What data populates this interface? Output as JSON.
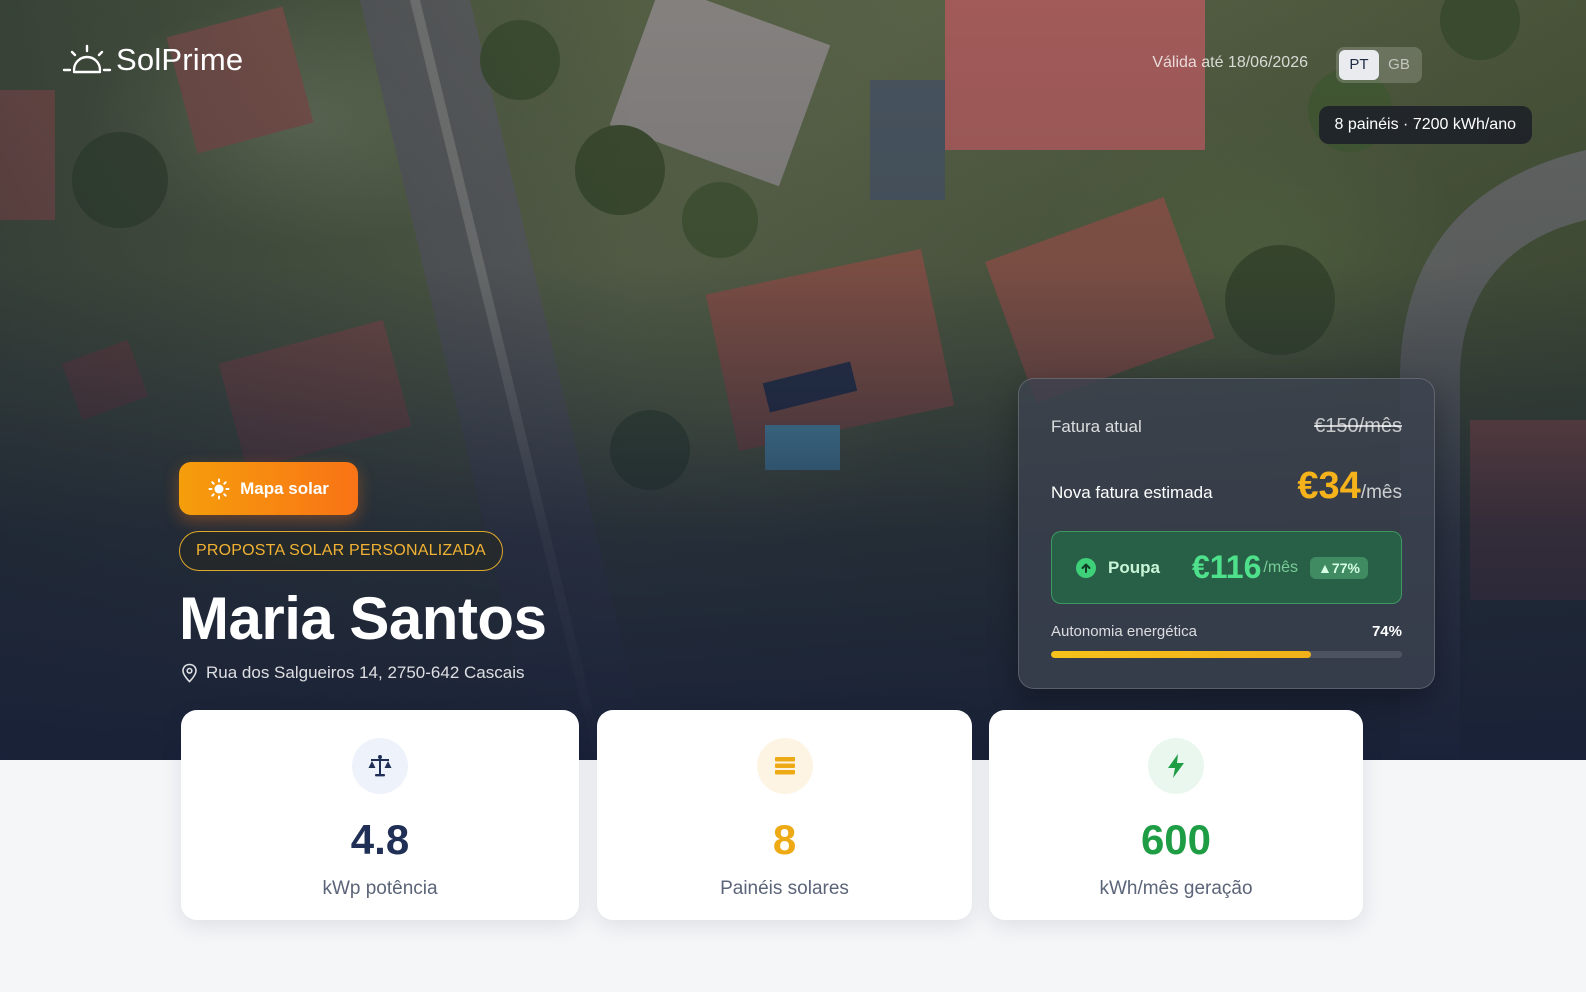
{
  "brand": {
    "name": "SolPrime",
    "icon": "sun-horizon-icon"
  },
  "validity": "Válida até 18/06/2026",
  "languages": [
    {
      "code": "PT",
      "active": true
    },
    {
      "code": "GB",
      "active": false
    }
  ],
  "system_summary": "8 painéis · 7200 kWh/ano",
  "hero": {
    "map_button_label": "Mapa solar",
    "proposal_tag": "PROPOSTA SOLAR PERSONALIZADA",
    "client_name": "Maria Santos",
    "address": "Rua dos Salgueiros 14, 2750-642 Cascais"
  },
  "savings": {
    "current_label": "Fatura atual",
    "current_value": "€150/mês",
    "new_label": "Nova fatura estimada",
    "new_value": "€34",
    "new_unit": "/mês",
    "save_label": "Poupa",
    "save_value": "€116",
    "save_unit": "/mês",
    "save_pct": "▲77%",
    "autonomy_label": "Autonomia energética",
    "autonomy_value": "74%",
    "autonomy_fraction": 0.74
  },
  "stats": [
    {
      "value": "4.8",
      "label": "kWp potência",
      "icon": "scale-icon",
      "color": "#1f2f55",
      "icon_bg": "#eef2fb"
    },
    {
      "value": "8",
      "label": "Painéis solares",
      "icon": "solar-panel-icon",
      "color": "#eeaa14",
      "icon_bg": "#fdf4e3"
    },
    {
      "value": "600",
      "label": "kWh/mês geração",
      "icon": "lightning-icon",
      "color": "#1f9d45",
      "icon_bg": "#e9f7ee"
    }
  ],
  "colors": {
    "accent": "#f59e0b",
    "navy": "#1f2a44",
    "green": "#22a350"
  }
}
